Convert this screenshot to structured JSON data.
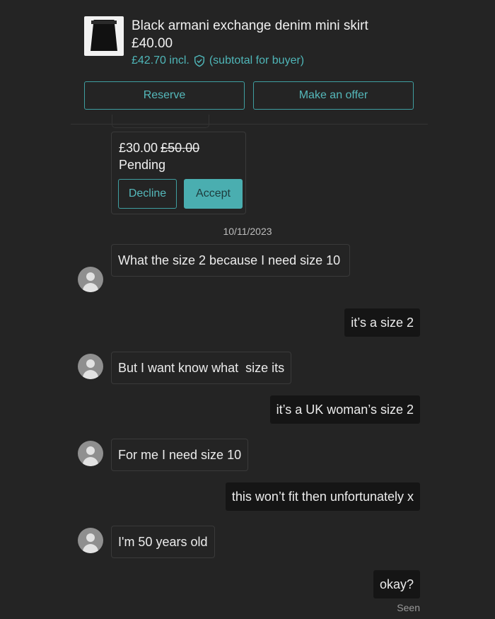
{
  "item": {
    "title": "Black armani exchange denim mini skirt",
    "price": "£40.00",
    "price_incl": "£42.70 incl.",
    "subtotal_note": "(subtotal for buyer)",
    "reserve_label": "Reserve",
    "offer_label": "Make an offer",
    "accent_color": "#4aaeb0"
  },
  "offer": {
    "offered_price": "£30.00",
    "original_price": "£50.00",
    "status": "Pending",
    "decline_label": "Decline",
    "accept_label": "Accept"
  },
  "conversation": {
    "date": "10/11/2023",
    "messages": [
      {
        "from": "buyer",
        "text": "What the size 2 because I need size 10"
      },
      {
        "from": "seller",
        "text": "it’s a size 2"
      },
      {
        "from": "buyer",
        "text": "But I want know what  size its"
      },
      {
        "from": "seller",
        "text": "it’s a UK woman’s size 2"
      },
      {
        "from": "buyer",
        "text": "For me I need size 10"
      },
      {
        "from": "seller",
        "text": "this won’t fit then unfortunately x"
      },
      {
        "from": "buyer",
        "text": "I'm 50 years old"
      },
      {
        "from": "seller",
        "text": "okay?"
      }
    ],
    "seen_label": "Seen"
  },
  "icons": {
    "buyer_avatar": "avatar-placeholder-icon",
    "buyer_protection": "shield-check-icon"
  }
}
